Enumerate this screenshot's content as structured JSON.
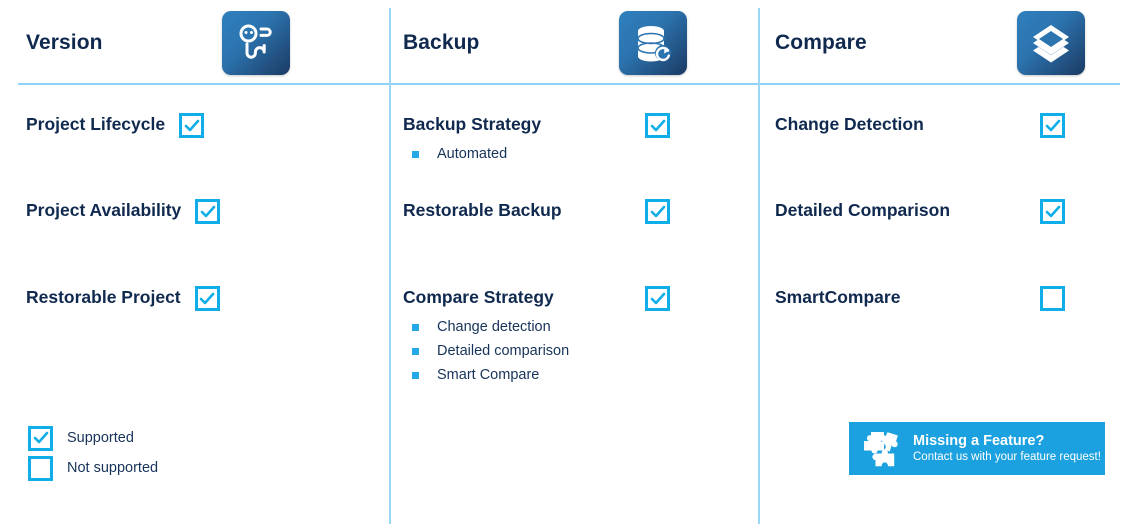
{
  "theme": {
    "navy": "#10294F",
    "cyan": "#0FAEE8",
    "rule": "#8DD3F7",
    "banner_bg": "#1BA1DF",
    "bullet": "#23A9E6"
  },
  "columns": [
    {
      "id": "version",
      "title": "Version",
      "icon": "version-control-icon",
      "features": [
        {
          "label": "Project Lifecycle",
          "supported": true,
          "checkbox_mode": "inline",
          "sub_items": []
        },
        {
          "label": "Project Availability",
          "supported": true,
          "checkbox_mode": "inline",
          "sub_items": []
        },
        {
          "label": "Restorable Project",
          "supported": true,
          "checkbox_mode": "inline",
          "sub_items": []
        }
      ]
    },
    {
      "id": "backup",
      "title": "Backup",
      "icon": "database-backup-icon",
      "features": [
        {
          "label": "Backup Strategy",
          "supported": true,
          "checkbox_mode": "fixed",
          "sub_items": [
            "Automated"
          ]
        },
        {
          "label": "Restorable Backup",
          "supported": true,
          "checkbox_mode": "fixed",
          "sub_items": []
        },
        {
          "label": "Compare Strategy",
          "supported": true,
          "checkbox_mode": "fixed",
          "sub_items": [
            "Change detection",
            "Detailed comparison",
            "Smart Compare"
          ]
        }
      ]
    },
    {
      "id": "compare",
      "title": "Compare",
      "icon": "layers-icon",
      "features": [
        {
          "label": "Change Detection",
          "supported": true,
          "checkbox_mode": "fixed",
          "sub_items": []
        },
        {
          "label": "Detailed Comparison",
          "supported": true,
          "checkbox_mode": "fixed",
          "sub_items": []
        },
        {
          "label": "SmartCompare",
          "supported": false,
          "checkbox_mode": "fixed",
          "sub_items": []
        }
      ]
    }
  ],
  "legend": {
    "items": [
      {
        "label": "Supported",
        "supported": true
      },
      {
        "label": "Not supported",
        "supported": false
      }
    ]
  },
  "banner": {
    "icon": "puzzle-piece-icon",
    "title": "Missing a Feature?",
    "subtitle": "Contact us with your feature request!"
  }
}
